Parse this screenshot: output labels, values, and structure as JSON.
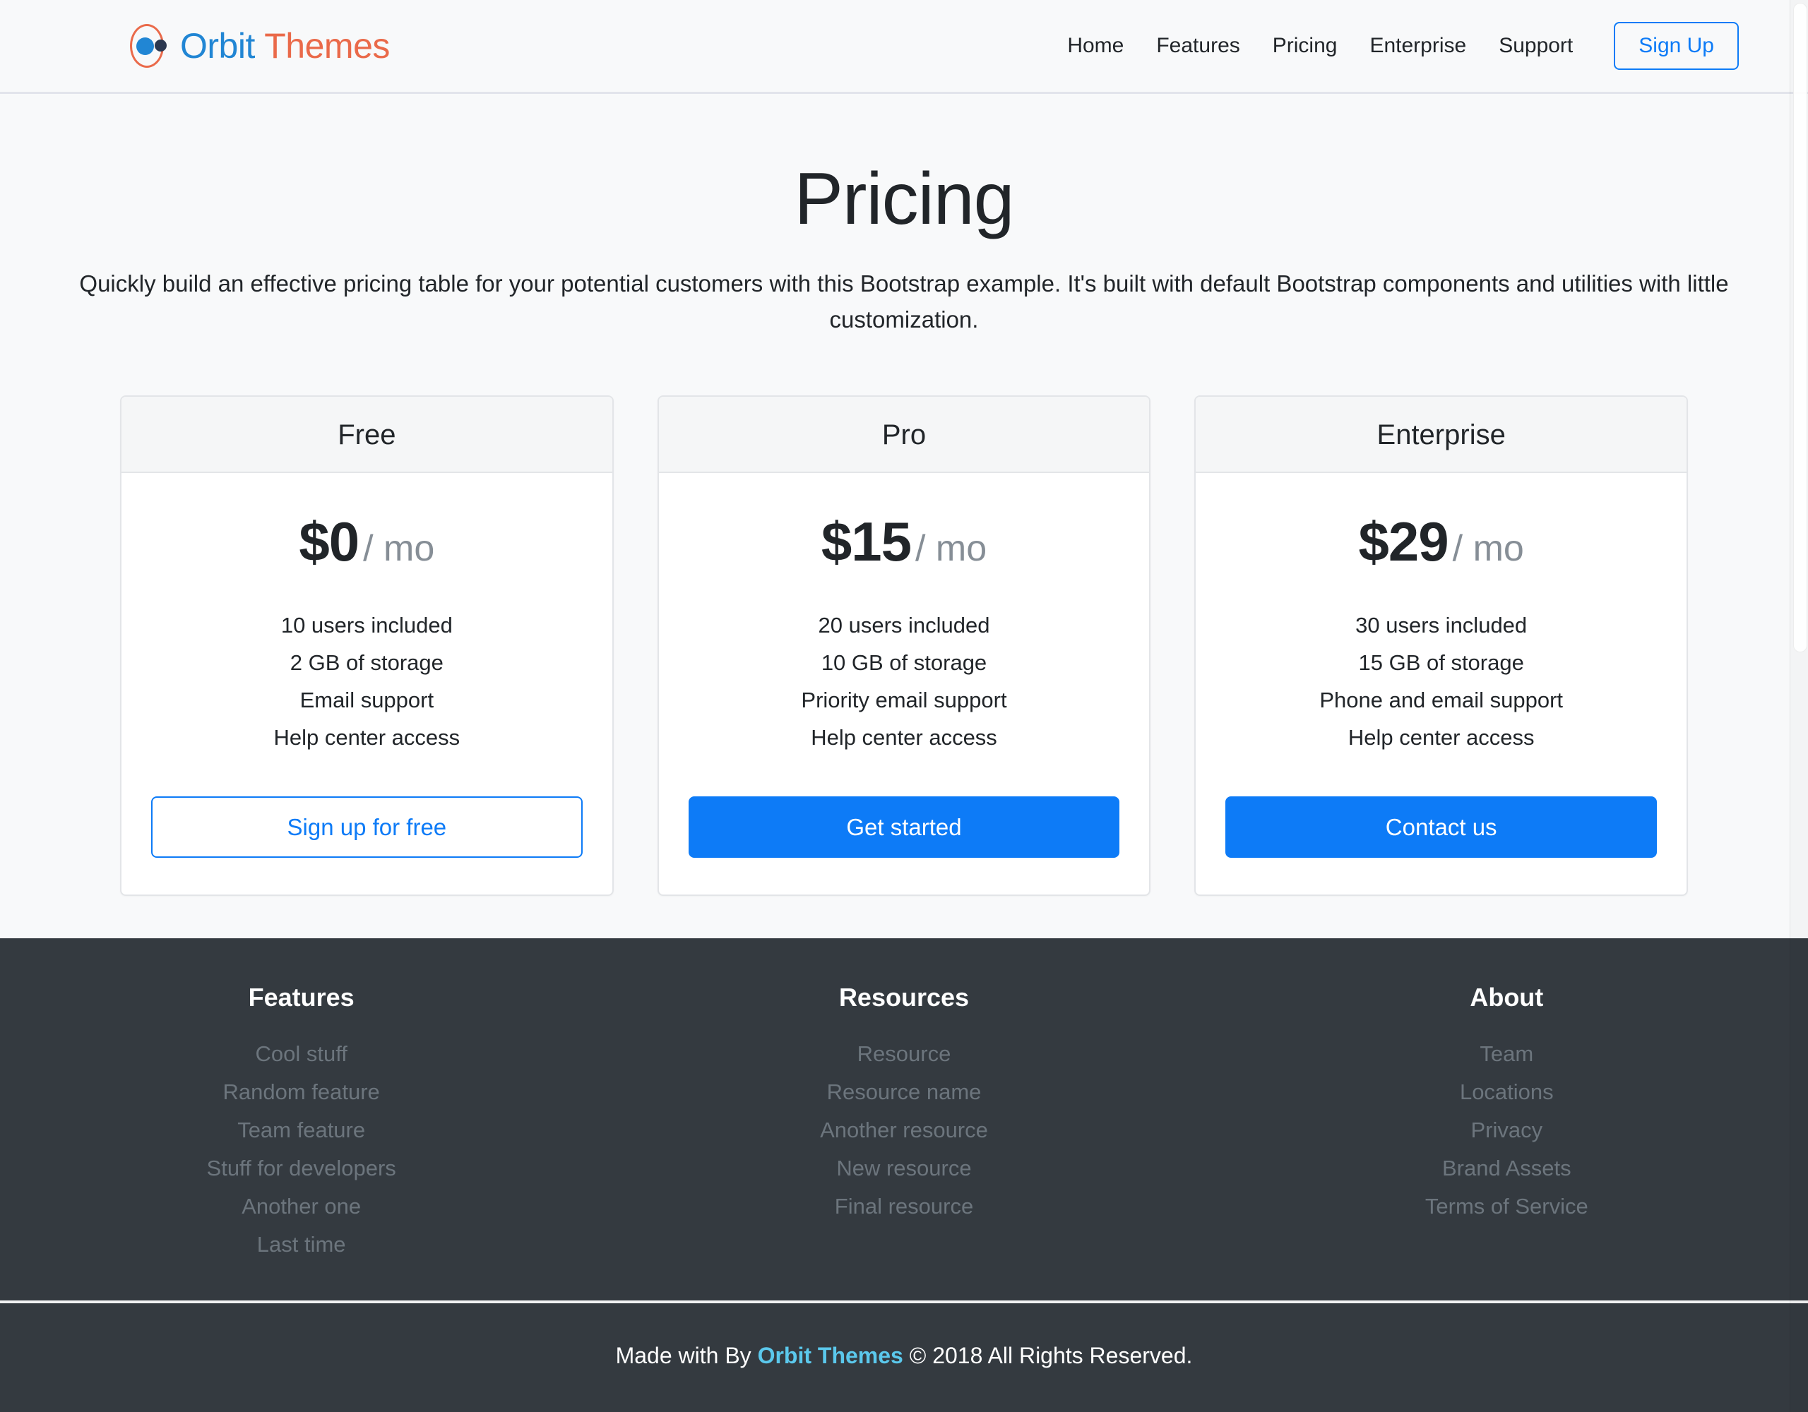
{
  "header": {
    "brand": {
      "word_one": "Orbit",
      "word_two": "Themes",
      "logo_icon": "orbit-logo-icon",
      "ring_color": "#ea6a4a",
      "planet_color": "#2186d4",
      "moon_color": "#2c3850",
      "word_one_color": "#2186d4",
      "word_two_color": "#ea6a4a"
    },
    "nav": [
      {
        "label": "Home"
      },
      {
        "label": "Features"
      },
      {
        "label": "Pricing"
      },
      {
        "label": "Enterprise"
      },
      {
        "label": "Support"
      }
    ],
    "signup_label": "Sign Up",
    "accent_color": "#0d7bf7"
  },
  "hero": {
    "title": "Pricing",
    "subtitle": "Quickly build an effective pricing table for your potential customers with this Bootstrap example. It's built with default Bootstrap components and utilities with little customization."
  },
  "pricing": {
    "plans": [
      {
        "name": "Free",
        "price": "$0",
        "period": "/ mo",
        "features": [
          "10 users included",
          "2 GB of storage",
          "Email support",
          "Help center access"
        ],
        "cta_label": "Sign up for free",
        "cta_style": "outline"
      },
      {
        "name": "Pro",
        "price": "$15",
        "period": "/ mo",
        "features": [
          "20 users included",
          "10 GB of storage",
          "Priority email support",
          "Help center access"
        ],
        "cta_label": "Get started",
        "cta_style": "solid"
      },
      {
        "name": "Enterprise",
        "price": "$29",
        "period": "/ mo",
        "features": [
          "30 users included",
          "15 GB of storage",
          "Phone and email support",
          "Help center access"
        ],
        "cta_label": "Contact us",
        "cta_style": "solid"
      }
    ]
  },
  "footer": {
    "background_color": "#343a40",
    "columns": [
      {
        "heading": "Features",
        "links": [
          "Cool stuff",
          "Random feature",
          "Team feature",
          "Stuff for developers",
          "Another one",
          "Last time"
        ]
      },
      {
        "heading": "Resources",
        "links": [
          "Resource",
          "Resource name",
          "Another resource",
          "New resource",
          "Final resource"
        ]
      },
      {
        "heading": "About",
        "links": [
          "Team",
          "Locations",
          "Privacy",
          "Brand Assets",
          "Terms of Service"
        ]
      }
    ],
    "copyright": {
      "prefix": "Made with By ",
      "brand": "Orbit Themes",
      "suffix": " © 2018 All Rights Reserved.",
      "brand_color": "#5bc8ec"
    }
  }
}
